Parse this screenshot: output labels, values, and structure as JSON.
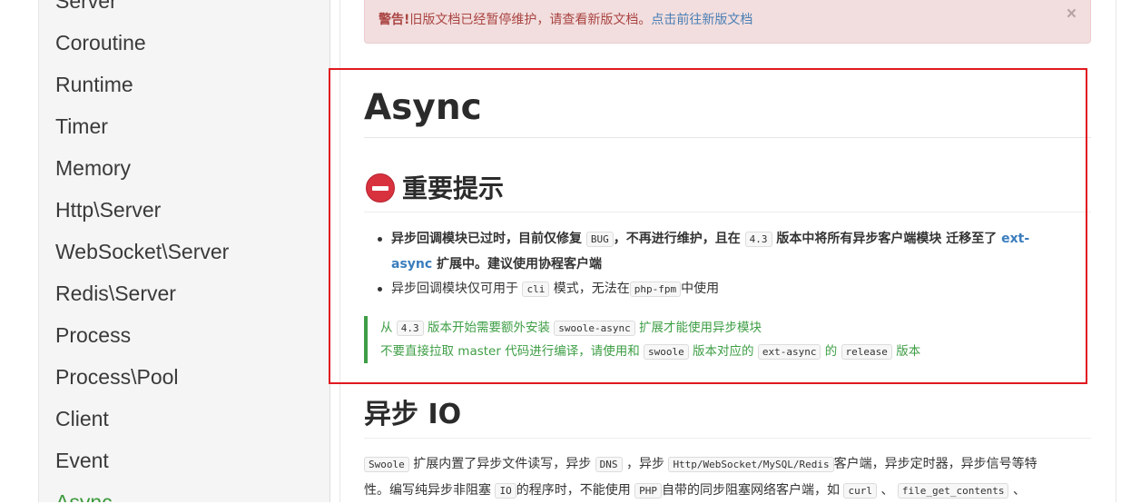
{
  "sidebar": {
    "items": [
      {
        "label": "Server"
      },
      {
        "label": "Coroutine"
      },
      {
        "label": "Runtime"
      },
      {
        "label": "Timer"
      },
      {
        "label": "Memory"
      },
      {
        "label": "Http\\Server"
      },
      {
        "label": "WebSocket\\Server"
      },
      {
        "label": "Redis\\Server"
      },
      {
        "label": "Process"
      },
      {
        "label": "Process\\Pool"
      },
      {
        "label": "Client"
      },
      {
        "label": "Event"
      },
      {
        "label": "Async"
      }
    ],
    "active_index": 12
  },
  "alert": {
    "prefix": "警告!",
    "message": "旧版文档已经暂停维护，请查看新版文档。",
    "link": "点击前往新版文档",
    "close": "×"
  },
  "page": {
    "title": "Async",
    "warning_heading": "重要提示",
    "bullet1": {
      "part1": "异步回调模块已过时，目前仅修复",
      "code1": "BUG",
      "part2": "，不再进行维护，且在",
      "code2": "4.3",
      "part3": "版本中将所有异步客户端模块 迁移至了",
      "link_a": "ext-",
      "link_b": "async",
      "part4": "扩展中。建议使用协程客户端"
    },
    "bullet2": {
      "part1": "异步回调模块仅可用于",
      "code1": "cli",
      "part2": "模式，无法在",
      "code2": "php-fpm",
      "part3": "中使用"
    },
    "quote": {
      "l1_a": "从",
      "l1_code1": "4.3",
      "l1_b": "版本开始需要额外安装",
      "l1_code2": "swoole-async",
      "l1_c": "扩展才能使用异步模块",
      "l2_a": "不要直接拉取 master 代码进行编译，请使用和",
      "l2_code1": "swoole",
      "l2_b": "版本对应的",
      "l2_code2": "ext-async",
      "l2_c": "的",
      "l2_code3": "release",
      "l2_d": "版本"
    },
    "section2_title": "异步 IO",
    "para": {
      "l1_code1": "Swoole",
      "l1_a": "扩展内置了异步文件读写，异步",
      "l1_code2": "DNS",
      "l1_b": "，异步",
      "l1_code3": "Http/WebSocket/MySQL/Redis",
      "l1_c": "客户端，异步定时器，异步信号等特",
      "l2_a": "性。编写纯异步非阻塞",
      "l2_code1": "IO",
      "l2_b": "的程序时，不能使用",
      "l2_code2": "PHP",
      "l2_c": "自带的同步阻塞网络客户端，如",
      "l2_code3": "curl",
      "l2_d": "、",
      "l2_code4": "file_get_contents",
      "l2_e": "、"
    }
  },
  "colors": {
    "alert_bg": "#f2dede",
    "alert_text": "#a94442",
    "link": "#3a7dbd",
    "quote_green": "#3e9e45",
    "highlight_box": "#e0191f",
    "active_nav": "#3c9a3c"
  }
}
